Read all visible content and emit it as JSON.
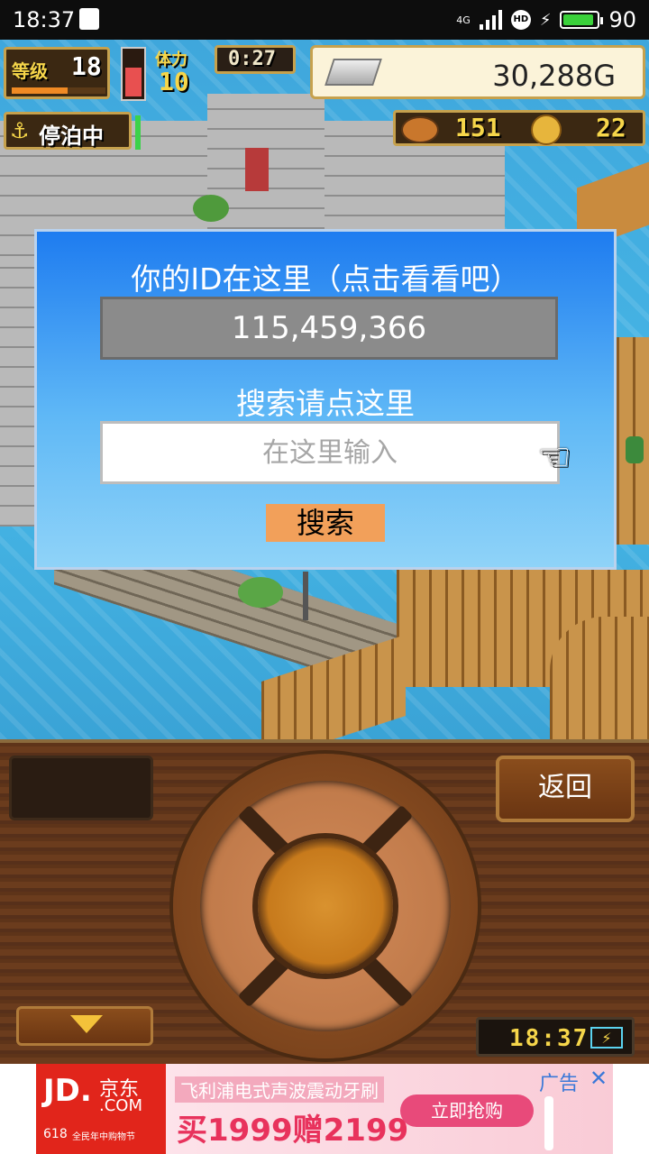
{
  "status_bar": {
    "time": "18:37",
    "network": "4G",
    "battery_level": "90"
  },
  "hud": {
    "level_label": "等级",
    "level_value": "18",
    "stat_label": "体力",
    "stat_value": "10",
    "timer": "0:27",
    "gold": "30,288G",
    "status_label": "停泊中",
    "food_value": "151",
    "coin_value": "22"
  },
  "dialog": {
    "id_title": "你的ID在这里（点击看看吧）",
    "id_value": "115,459,366",
    "search_title": "搜索请点这里",
    "search_placeholder": "在这里输入",
    "search_button": "搜索"
  },
  "controls": {
    "back_button": "返回",
    "clock": "18:37"
  },
  "ad": {
    "brand_top": "JD.",
    "brand_cn": "京东",
    "brand_com": ".COM",
    "brand_618": "618",
    "brand_sub": "全民年中购物节",
    "headline": "飞利浦电式声波震动牙刷",
    "offer": "买1999赠2199",
    "cta": "立即抢购",
    "ad_label": "广告"
  },
  "colors": {
    "dialog_top": "#1e7cf0",
    "dialog_bottom": "#8fd3f8",
    "search_button_bg": "#f2a05a",
    "hud_text": "#f6d64a"
  }
}
